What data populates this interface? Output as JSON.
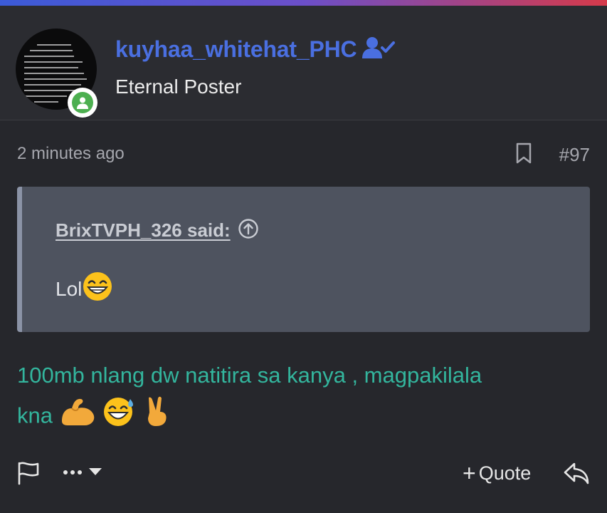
{
  "post": {
    "author": {
      "username": "kuyhaa_whitehat_PHC",
      "title": "Eternal Poster",
      "avatar_icon": "terminal-avatar",
      "online": true
    },
    "time": "2 minutes ago",
    "post_number": "#97",
    "quote": {
      "author_line": "BrixTVPH_326 said:",
      "text": "Lol"
    },
    "message": {
      "line1": "100mb nlang dw natitira sa kanya , magpakilala",
      "line2": "kna"
    },
    "actions": {
      "quote_label": "Quote",
      "plus": "+"
    }
  },
  "colors": {
    "background": "#26272c",
    "header": "#2b2c31",
    "username": "#4a6fe0",
    "message": "#33b59d",
    "quote_box": "#4e535f",
    "online": "#4caf50",
    "muted": "#a5a6ad"
  }
}
